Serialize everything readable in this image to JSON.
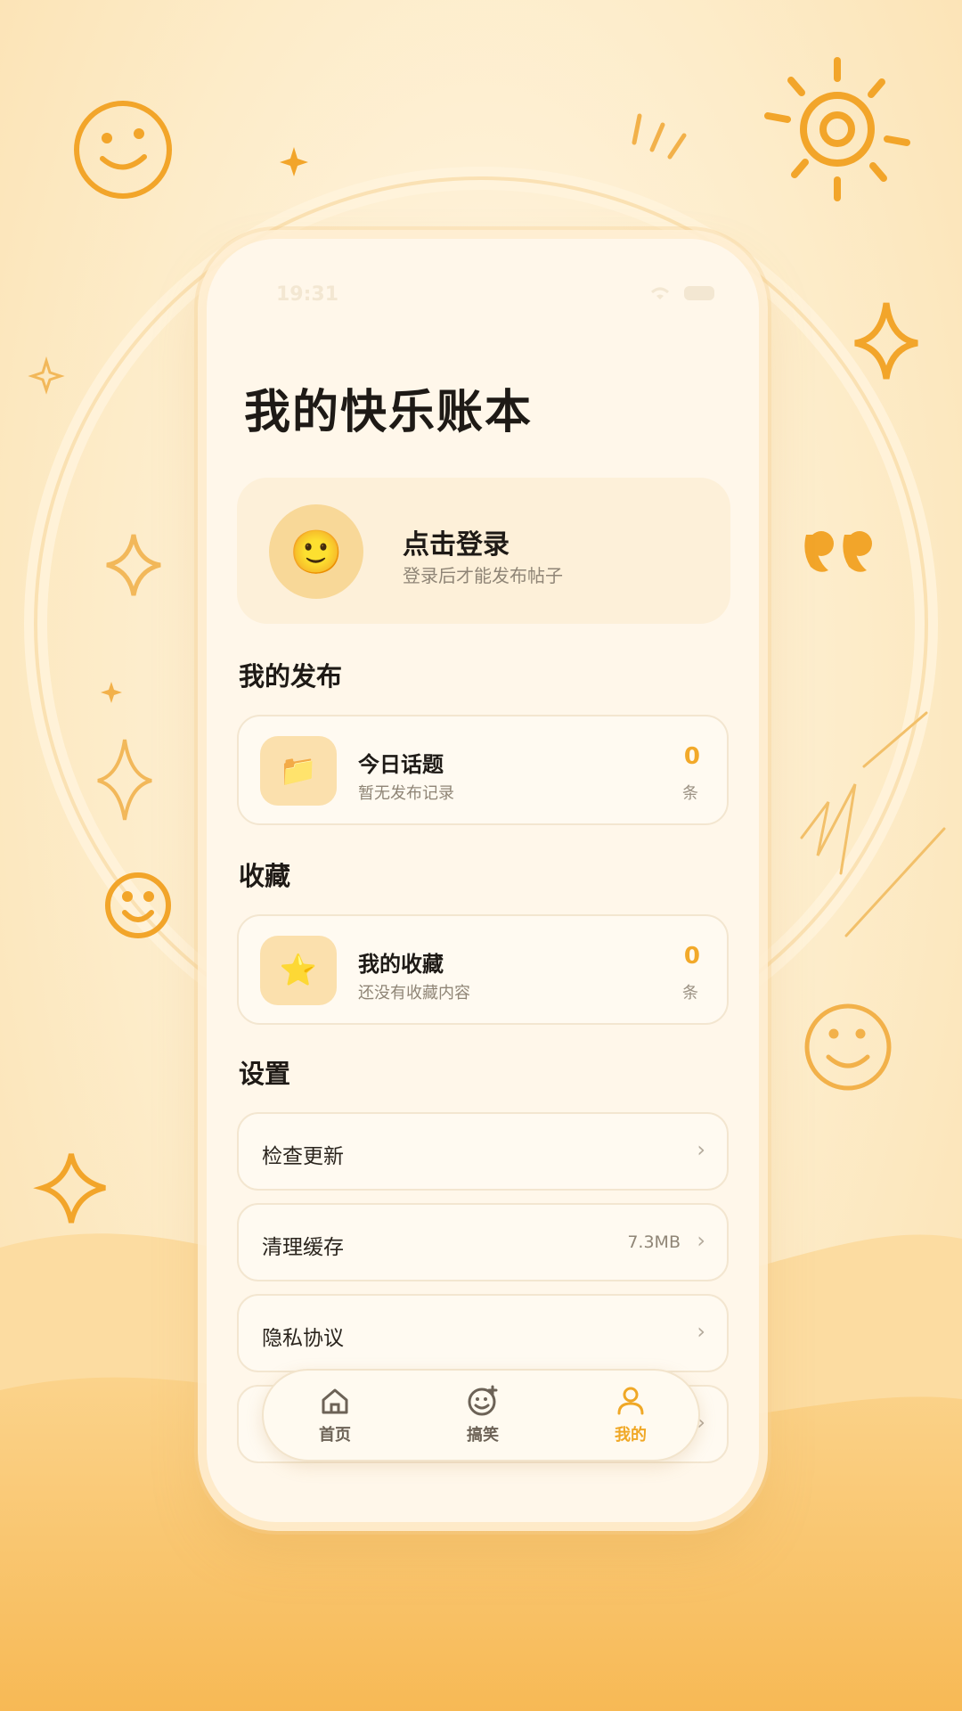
{
  "status_bar": {
    "time": "19:31"
  },
  "page": {
    "title": "我的快乐账本"
  },
  "login": {
    "avatar_emoji": "🙂",
    "title": "点击登录",
    "subtitle": "登录后才能发布帖子"
  },
  "sections": {
    "publish": "我的发布",
    "favorites": "收藏",
    "settings": "设置"
  },
  "publish_card": {
    "icon": "📁",
    "title": "今日话题",
    "subtitle": "暂无发布记录",
    "count": "0",
    "unit": "条"
  },
  "favorite_card": {
    "icon": "⭐",
    "title": "我的收藏",
    "subtitle": "还没有收藏内容",
    "count": "0",
    "unit": "条"
  },
  "settings": [
    {
      "label": "检查更新",
      "value": ""
    },
    {
      "label": "清理缓存",
      "value": "7.3MB"
    },
    {
      "label": "隐私协议",
      "value": ""
    }
  ],
  "chevron": "›",
  "tabs": [
    {
      "label": "首页",
      "icon": "home-icon",
      "active": false
    },
    {
      "label": "搞笑",
      "icon": "smile-plus-icon",
      "active": false
    },
    {
      "label": "我的",
      "icon": "user-icon",
      "active": true
    }
  ],
  "colors": {
    "accent": "#f0a826",
    "background": "#fdecc9",
    "card": "#fffaf1"
  }
}
